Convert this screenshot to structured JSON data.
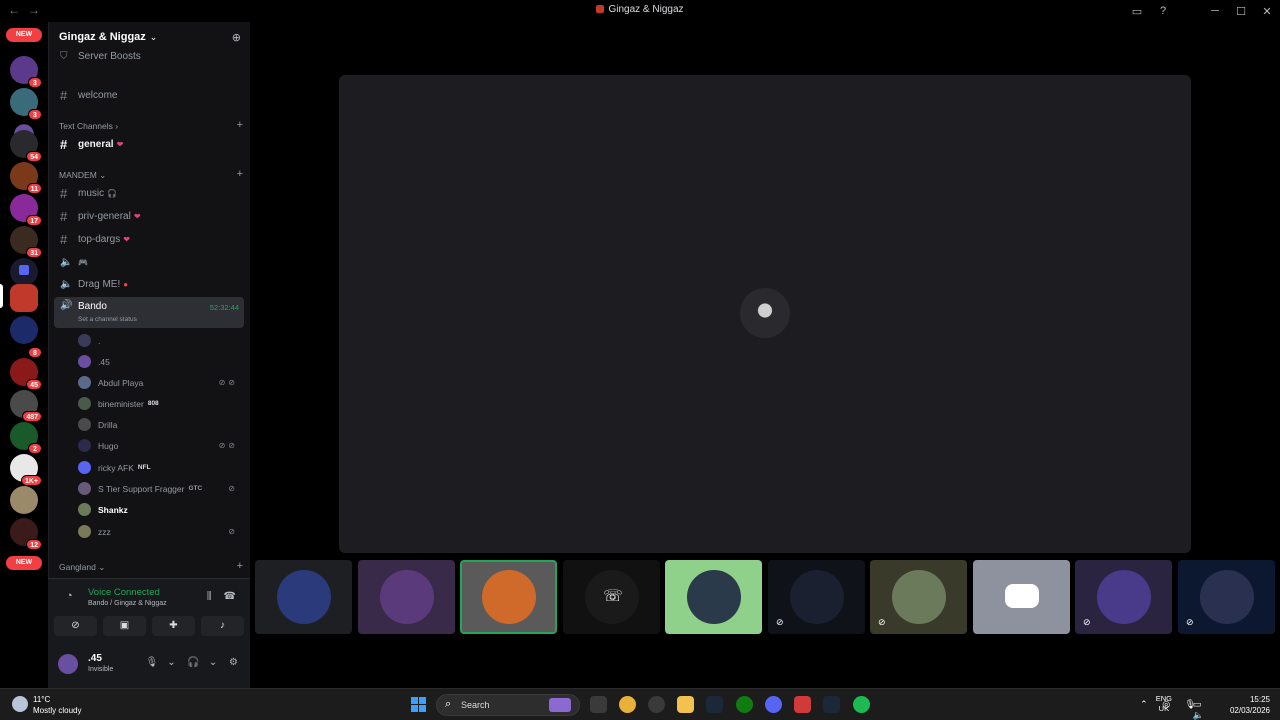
{
  "window": {
    "title": "Gingaz & Niggaz"
  },
  "rail": {
    "new_label": "NEW",
    "badges": [
      "3",
      "3",
      "54",
      "11",
      "17",
      "31",
      "8",
      "45",
      "487",
      "2",
      "1K+",
      "12"
    ]
  },
  "server": {
    "name": "Gingaz & Niggaz"
  },
  "channels": {
    "boosts": "Server Boosts",
    "welcome": "welcome",
    "text_category": "Text Channels",
    "general": "general",
    "mandem_category": "MANDEM",
    "music": "music",
    "priv_general": "priv-general",
    "top_dargs": "top-dargs",
    "drag_me": "Drag ME!",
    "bando": "Bando",
    "bando_timer": "52:32:44",
    "bando_status": "Set a channel status",
    "gangland_category": "Gangland"
  },
  "voice_users": [
    {
      "name": ".",
      "tag": ""
    },
    {
      "name": ".45",
      "tag": ""
    },
    {
      "name": "Abdul Playa",
      "tag": ""
    },
    {
      "name": "bineminister",
      "tag": "808"
    },
    {
      "name": "Drilla",
      "tag": ""
    },
    {
      "name": "Hugo",
      "tag": ""
    },
    {
      "name": "ricky AFK",
      "tag": "NFL"
    },
    {
      "name": "S Tier Support Fragger",
      "tag": "GTC"
    },
    {
      "name": "Shankz",
      "tag": ""
    },
    {
      "name": "zzz",
      "tag": ""
    }
  ],
  "voice_panel": {
    "status": "Voice Connected",
    "location": "Bando / Gingaz & Niggaz"
  },
  "user": {
    "name": ".45",
    "status": "Invisible"
  },
  "taskbar": {
    "temperature": "11°C",
    "condition": "Mostly cloudy",
    "search": "Search",
    "lang_line1": "ENG",
    "lang_line2": "UK",
    "time": "15:25",
    "date": "02/03/2026"
  },
  "colors": {
    "accent_green": "#23a55a",
    "badge_red": "#f23f43",
    "sidebar_bg": "#121214",
    "stage_tile_bg": "#1d1d21"
  }
}
